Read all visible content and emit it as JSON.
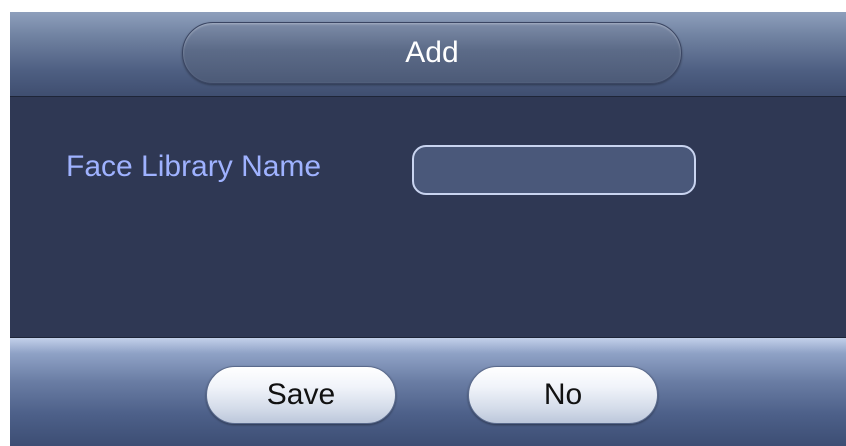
{
  "dialog": {
    "title": "Add",
    "field": {
      "label": "Face Library Name",
      "value": "",
      "placeholder": ""
    },
    "buttons": {
      "save_label": "Save",
      "no_label": "No"
    }
  },
  "colors": {
    "background": "#2f3854",
    "label": "#9fb2ff",
    "input_border": "#c9d4f0"
  }
}
